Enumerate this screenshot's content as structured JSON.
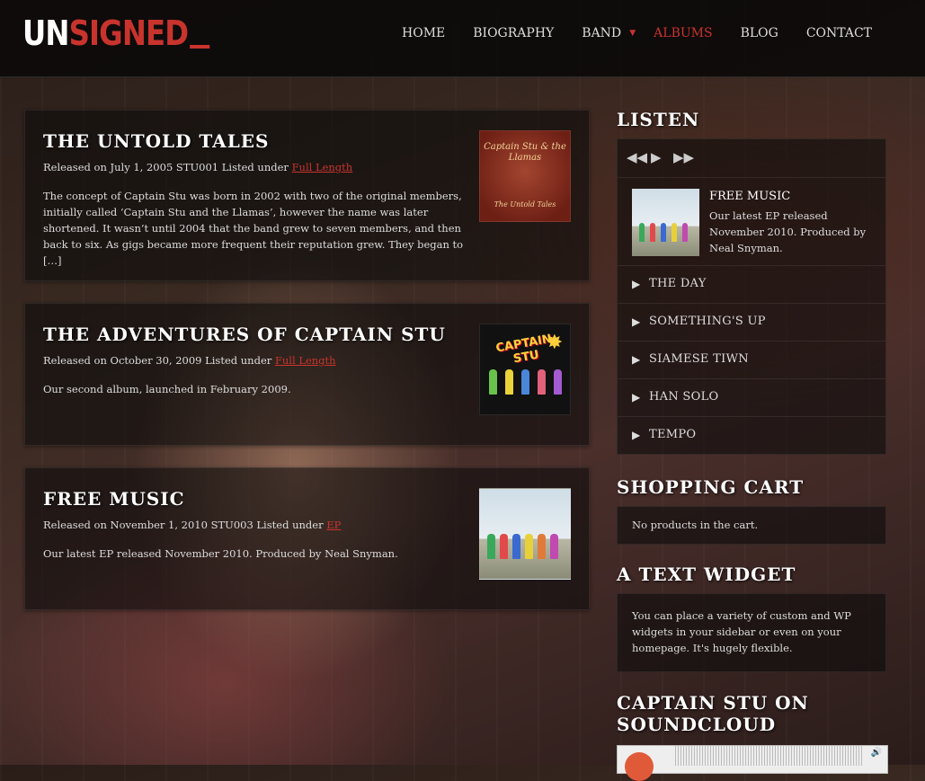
{
  "logo": {
    "part1": "UN",
    "part2": "SIGNED"
  },
  "nav": {
    "items": [
      {
        "label": "HOME"
      },
      {
        "label": "BIOGRAPHY"
      },
      {
        "label": "BAND"
      },
      {
        "label": "ALBUMS"
      },
      {
        "label": "BLOG"
      },
      {
        "label": "CONTACT"
      }
    ],
    "active": "ALBUMS"
  },
  "albums": [
    {
      "title": "THE UNTOLD TALES",
      "released_prefix": "Released on July 1, 2005 STU001 Listed under ",
      "category": "Full Length",
      "description": "The concept of Captain Stu was born in 2002 with two of the original members, initially called ‘Captain Stu and the Llamas’, however the name was later shortened. It wasn’t until 2004 that the band grew to seven members, and then back to six. As gigs became more frequent their reputation grew. They began to […]",
      "cover_text": "Captain Stu & the Llamas",
      "cover_sub": "The Untold Tales"
    },
    {
      "title": "THE ADVENTURES OF CAPTAIN STU",
      "released_prefix": "Released on October 30, 2009 Listed under ",
      "category": "Full Length",
      "description": "Our second album, launched in February 2009.",
      "cover_text": "CAPTAIN STU"
    },
    {
      "title": "FREE MUSIC",
      "released_prefix": "Released on November 1, 2010 STU003 Listed under ",
      "category": "EP",
      "description": "Our latest EP released November 2010. Produced by Neal Snyman."
    }
  ],
  "sidebar": {
    "listen": {
      "title": "LISTEN",
      "now_playing": {
        "title": "FREE MUSIC",
        "text": "Our latest EP released November 2010. Produced by Neal Snyman."
      },
      "tracks": [
        {
          "name": "THE DAY"
        },
        {
          "name": "SOMETHING'S UP"
        },
        {
          "name": "SIAMESE TIWN"
        },
        {
          "name": "HAN SOLO"
        },
        {
          "name": "TEMPO"
        }
      ]
    },
    "cart": {
      "title": "SHOPPING CART",
      "text": "No products in the cart."
    },
    "text_widget": {
      "title": "A TEXT WIDGET",
      "text": "You can place a variety of custom and WP widgets in your sidebar or even on your homepage. It's hugely flexible."
    },
    "soundcloud": {
      "title": "CAPTAIN STU ON SOUNDCLOUD"
    }
  },
  "icons": {
    "prev": "rewind-icon",
    "play": "play-icon",
    "next": "fast-forward-icon",
    "track": "play-icon",
    "caret": "caret-down-icon"
  },
  "colors": {
    "accent": "#c8342d",
    "header_bg": "#0c0a0a"
  }
}
